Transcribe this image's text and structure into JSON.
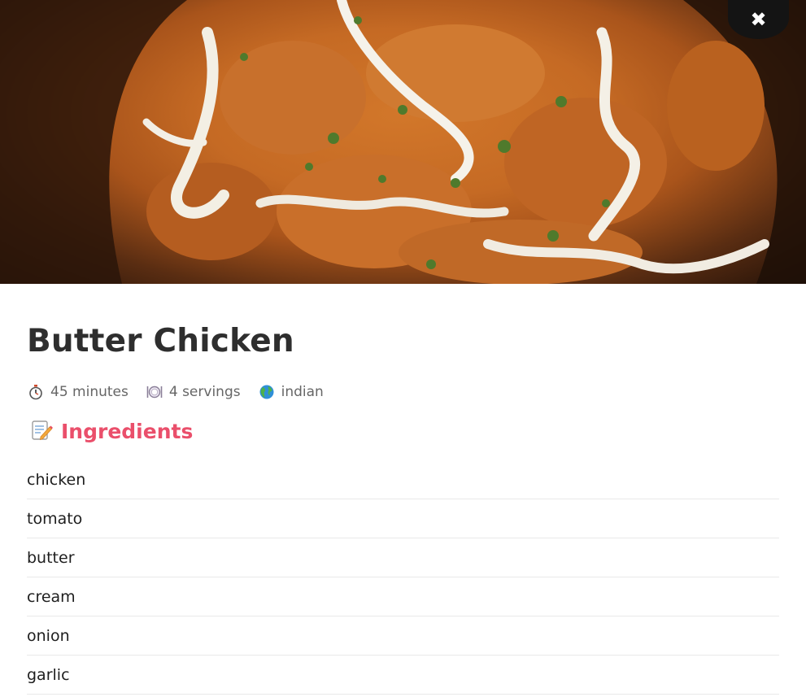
{
  "hero": {
    "image_name": "butter-chicken-photo",
    "close_label": "✖"
  },
  "recipe": {
    "title": "Butter Chicken",
    "meta": {
      "time": "45 minutes",
      "servings": "4 servings",
      "cuisine": "indian"
    },
    "ingredients_heading": "Ingredients",
    "ingredients": [
      "chicken",
      "tomato",
      "butter",
      "cream",
      "onion",
      "garlic"
    ]
  },
  "colors": {
    "accent": "#ea4f6b",
    "title": "#2e2e2e",
    "meta_text": "#666666",
    "divider": "#e9e9e9",
    "close_button": "#141414"
  },
  "icons": {
    "time": "stopwatch-icon",
    "servings": "plate-icon",
    "cuisine": "globe-icon",
    "ingredients": "memo-icon",
    "close": "close-icon"
  }
}
